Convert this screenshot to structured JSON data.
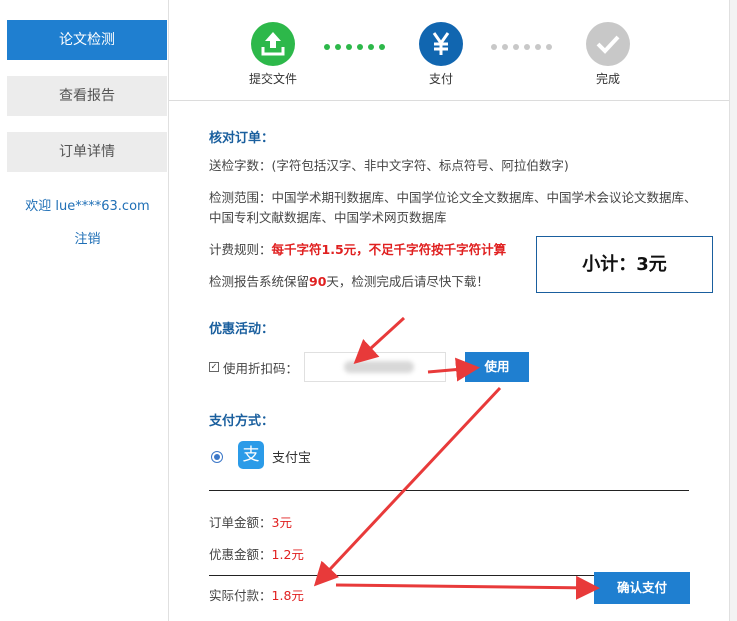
{
  "sidebar": {
    "items": [
      {
        "label": "论文检测",
        "active": true
      },
      {
        "label": "查看报告",
        "active": false
      },
      {
        "label": "订单详情",
        "active": false
      }
    ],
    "welcome": "欢迎 lue****63.com",
    "logout": "注销"
  },
  "steps": [
    {
      "label": "提交文件",
      "icon": "upload-icon",
      "color": "#2db84a"
    },
    {
      "label": "支付",
      "icon": "yen-icon",
      "color": "#1166b0"
    },
    {
      "label": "完成",
      "icon": "check-icon",
      "color": "#c8c8c8"
    }
  ],
  "order": {
    "title": "核对订单：",
    "char_count_label": "送检字数：",
    "char_count_note": "(字符包括汉字、非中文字符、标点符号、阿拉伯数字)",
    "scope_label": "检测范围：",
    "scope_text": "中国学术期刊数据库、中国学位论文全文数据库、中国学术会议论文数据库、",
    "scope_text2": "中国专利文献数据库、中国学术网页数据库",
    "fee_label": "计费规则：",
    "fee_text": "每千字符1.5元，不足千字符按千字符计算",
    "retain_prefix": "检测报告系统保留",
    "retain_days": "90",
    "retain_suffix": "天，检测完成后请尽快下载！",
    "subtotal": "小计：3元"
  },
  "discount": {
    "title": "优惠活动：",
    "checkbox_label": "使用折扣码：",
    "checked": true,
    "code_value": "",
    "use_button": "使用"
  },
  "payment": {
    "title": "支付方式：",
    "method": "支付宝",
    "logo_char": "支"
  },
  "amounts": {
    "order_label": "订单金额：",
    "order_value": "3元",
    "discount_label": "优惠金额：",
    "discount_value": "1.2元",
    "actual_label": "实际付款：",
    "actual_value": "1.8元",
    "confirm_button": "确认支付"
  },
  "colors": {
    "accent": "#1f7fd0",
    "highlight": "#e02020",
    "arrow": "#e83a3a"
  }
}
